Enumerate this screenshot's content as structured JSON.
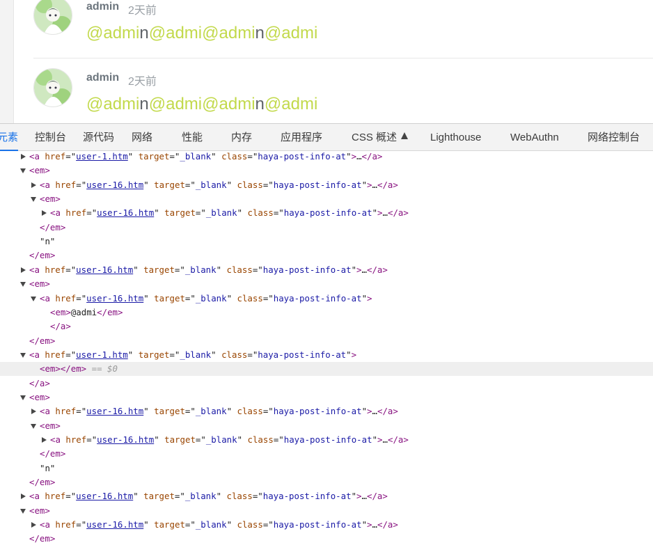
{
  "posts": [
    {
      "user": "admin",
      "time": "2天前",
      "segments": [
        {
          "text": "@admi",
          "type": "at"
        },
        {
          "text": "n",
          "type": "plain"
        },
        {
          "text": "@admi",
          "type": "at"
        },
        {
          "text": "@admi",
          "type": "at"
        },
        {
          "text": "n",
          "type": "plain"
        },
        {
          "text": "@admi",
          "type": "at"
        }
      ]
    },
    {
      "user": "admin",
      "time": "2天前",
      "segments": [
        {
          "text": "@admi",
          "type": "at"
        },
        {
          "text": "n",
          "type": "plain"
        },
        {
          "text": "@admi",
          "type": "at"
        },
        {
          "text": "@admi",
          "type": "at"
        },
        {
          "text": "n",
          "type": "plain"
        },
        {
          "text": "@admi",
          "type": "at"
        }
      ]
    }
  ],
  "devtools": {
    "tabs": [
      {
        "label": "元素",
        "active": true
      },
      {
        "label": "控制台"
      },
      {
        "label": "源代码"
      },
      {
        "label": "网络"
      },
      {
        "label": "性能"
      },
      {
        "label": "内存"
      },
      {
        "label": "应用程序"
      },
      {
        "label": "CSS 概述"
      },
      {
        "label": "Lighthouse"
      },
      {
        "label": "WebAuthn"
      },
      {
        "label": "网络控制台"
      }
    ],
    "tree": [
      {
        "depth": 0,
        "toggle": "right",
        "kind": "a",
        "href": "user-1.htm",
        "collapsed": true
      },
      {
        "depth": 0,
        "toggle": "down",
        "kind": "open",
        "tag": "em"
      },
      {
        "depth": 1,
        "toggle": "right",
        "kind": "a",
        "href": "user-16.htm",
        "collapsed": true
      },
      {
        "depth": 1,
        "toggle": "down",
        "kind": "open",
        "tag": "em"
      },
      {
        "depth": 2,
        "toggle": "right",
        "kind": "a",
        "href": "user-16.htm",
        "collapsed": true
      },
      {
        "depth": 1,
        "kind": "close",
        "tag": "em"
      },
      {
        "depth": 1,
        "kind": "text",
        "text": "\"n\""
      },
      {
        "depth": 0,
        "kind": "close",
        "tag": "em"
      },
      {
        "depth": 0,
        "toggle": "right",
        "kind": "a",
        "href": "user-16.htm",
        "collapsed": true
      },
      {
        "depth": 0,
        "toggle": "down",
        "kind": "open",
        "tag": "em"
      },
      {
        "depth": 1,
        "toggle": "down",
        "kind": "a",
        "href": "user-16.htm",
        "collapsed": false
      },
      {
        "depth": 2,
        "kind": "inline",
        "tag": "em",
        "text": "@admi"
      },
      {
        "depth": 2,
        "kind": "close",
        "tag": "a"
      },
      {
        "depth": 0,
        "kind": "close",
        "tag": "em"
      },
      {
        "depth": 0,
        "toggle": "down",
        "kind": "a",
        "href": "user-1.htm",
        "collapsed": false
      },
      {
        "depth": 1,
        "kind": "inline",
        "tag": "em",
        "text": "",
        "selected": true,
        "marker": "== $0"
      },
      {
        "depth": 0,
        "kind": "close",
        "tag": "a"
      },
      {
        "depth": 0,
        "toggle": "down",
        "kind": "open",
        "tag": "em"
      },
      {
        "depth": 1,
        "toggle": "right",
        "kind": "a",
        "href": "user-16.htm",
        "collapsed": true
      },
      {
        "depth": 1,
        "toggle": "down",
        "kind": "open",
        "tag": "em"
      },
      {
        "depth": 2,
        "toggle": "right",
        "kind": "a",
        "href": "user-16.htm",
        "collapsed": true
      },
      {
        "depth": 1,
        "kind": "close",
        "tag": "em"
      },
      {
        "depth": 1,
        "kind": "text",
        "text": "\"n\""
      },
      {
        "depth": 0,
        "kind": "close",
        "tag": "em"
      },
      {
        "depth": 0,
        "toggle": "right",
        "kind": "a",
        "href": "user-16.htm",
        "collapsed": true
      },
      {
        "depth": 0,
        "toggle": "down",
        "kind": "open",
        "tag": "em"
      },
      {
        "depth": 1,
        "toggle": "right",
        "kind": "a",
        "href": "user-16.htm",
        "collapsed": true
      },
      {
        "depth": 0,
        "kind": "close",
        "tag": "em"
      }
    ],
    "a_attrs": {
      "target": "_blank",
      "class": "haya-post-info-at"
    },
    "ellipsis": "…",
    "more_indicator": "..."
  },
  "colors": {
    "mention": "#c2d94b",
    "active_tab": "#1a73e8",
    "tag": "#881280",
    "attr_name": "#994500",
    "attr_value": "#1a1aa6"
  }
}
